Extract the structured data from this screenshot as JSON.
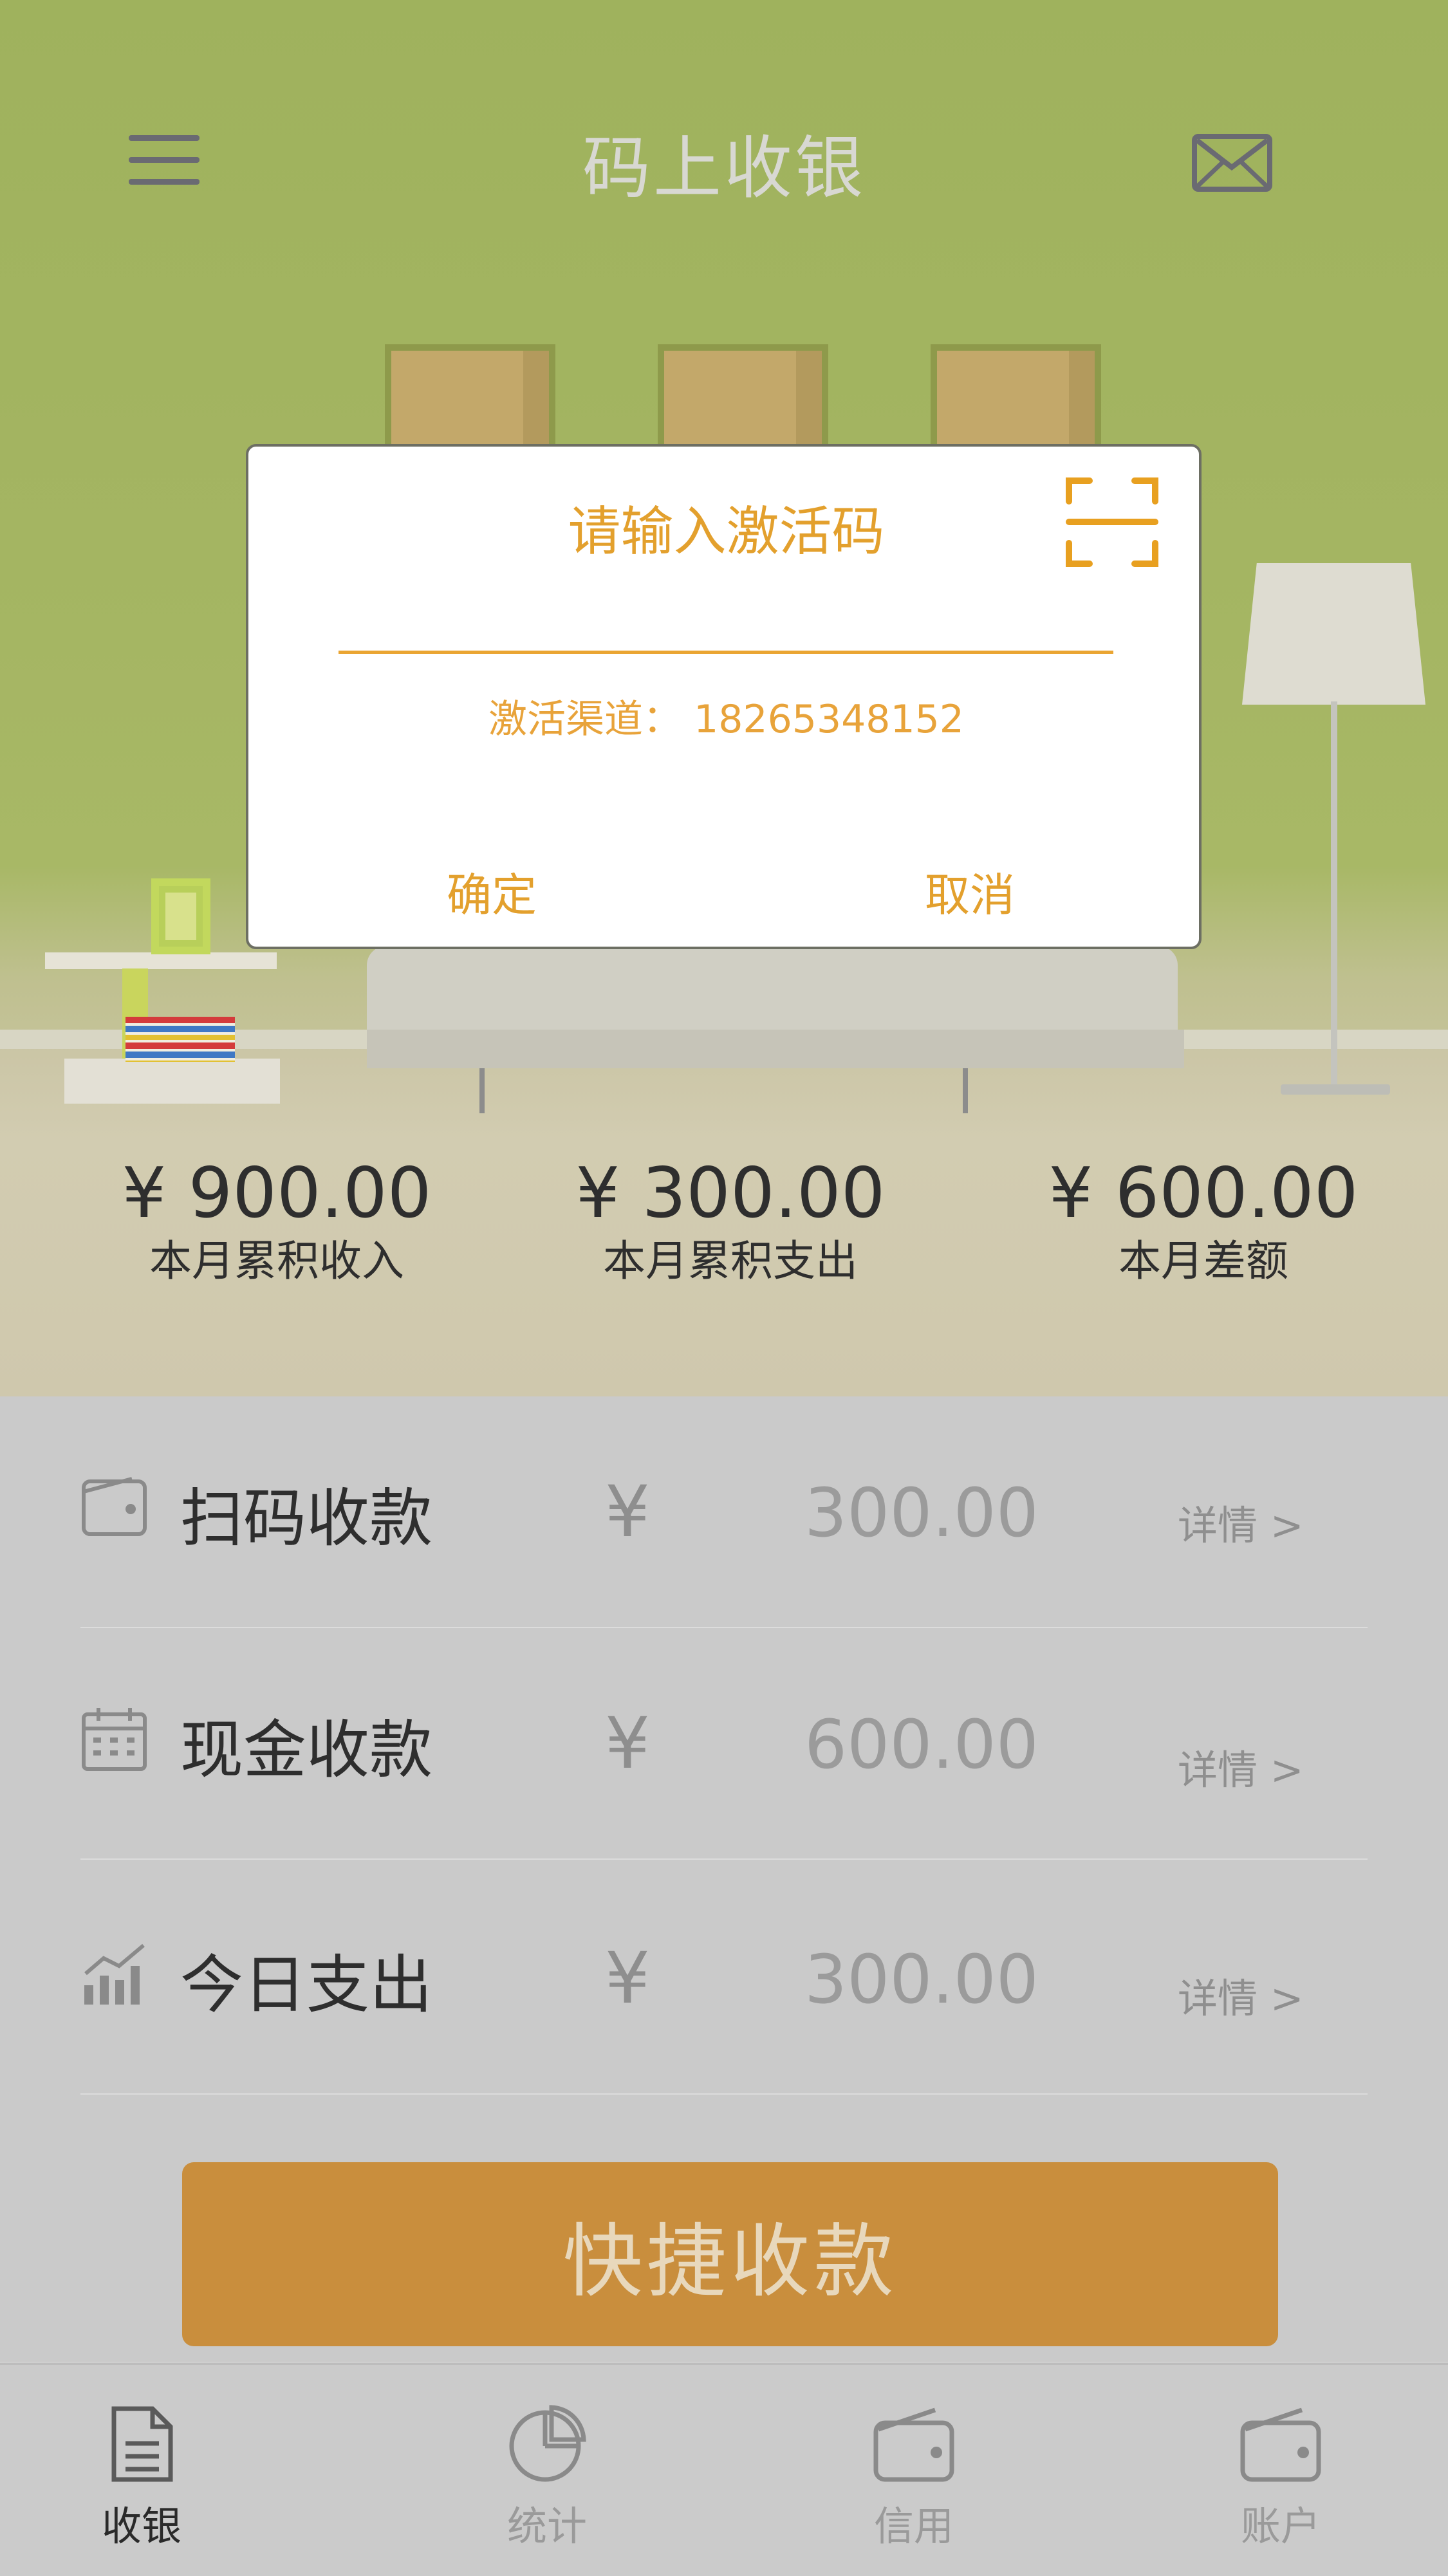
{
  "header": {
    "title": "码上收银",
    "menu_icon": "hamburger-icon",
    "mail_icon": "envelope-icon"
  },
  "stats": [
    {
      "amount": "¥ 900.00",
      "label": "本月累积收入"
    },
    {
      "amount": "¥ 300.00",
      "label": "本月累积支出"
    },
    {
      "amount": "¥ 600.00",
      "label": "本月差额"
    }
  ],
  "rows": [
    {
      "icon": "wallet-icon",
      "name": "扫码收款",
      "currency": "¥",
      "amount": "300.00",
      "detail": "详情  >"
    },
    {
      "icon": "calendar-icon",
      "name": "现金收款",
      "currency": "¥",
      "amount": "600.00",
      "detail": "详情  >"
    },
    {
      "icon": "bar-chart-icon",
      "name": "今日支出",
      "currency": "¥",
      "amount": "300.00",
      "detail": "详情  >"
    }
  ],
  "quick_pay_label": "快捷收款",
  "tabs": [
    {
      "icon": "document-icon",
      "label": "收银",
      "active": true
    },
    {
      "icon": "pie-chart-icon",
      "label": "统计",
      "active": false
    },
    {
      "icon": "wallet-icon",
      "label": "信用",
      "active": false
    },
    {
      "icon": "wallet-icon",
      "label": "账户",
      "active": false
    }
  ],
  "dialog": {
    "title": "请输入激活码",
    "input_value": "",
    "channel": "激活渠道： 18265348152",
    "confirm_label": "确定",
    "cancel_label": "取消",
    "scan_icon": "scan-icon"
  },
  "colors": {
    "accent": "#e3a02d",
    "quick_pay_bg": "#c98e3d",
    "wall": "#a4b562"
  }
}
